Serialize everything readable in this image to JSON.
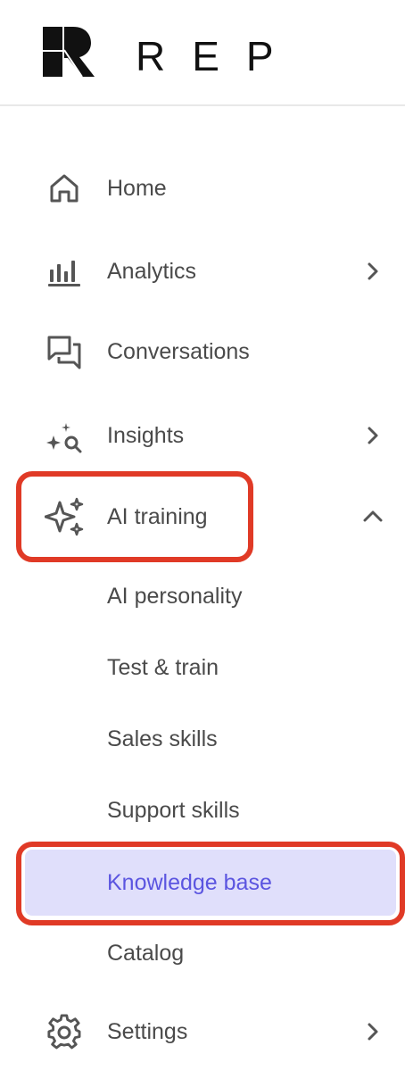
{
  "brand": {
    "wordmark": "REP"
  },
  "nav": {
    "home": {
      "label": "Home",
      "icon": "home-icon"
    },
    "analytics": {
      "label": "Analytics",
      "icon": "bar-chart-icon"
    },
    "conversations": {
      "label": "Conversations",
      "icon": "chat-bubbles-icon"
    },
    "insights": {
      "label": "Insights",
      "icon": "sparkle-search-icon"
    },
    "ai_training": {
      "label": "AI training",
      "icon": "sparkles-icon",
      "expanded": true,
      "children": [
        {
          "label": "AI personality"
        },
        {
          "label": "Test & train"
        },
        {
          "label": "Sales skills"
        },
        {
          "label": "Support skills"
        },
        {
          "label": "Knowledge base",
          "active": true
        },
        {
          "label": "Catalog"
        }
      ]
    },
    "settings": {
      "label": "Settings",
      "icon": "gear-icon"
    }
  },
  "colors": {
    "active_bg": "#e0dffb",
    "active_text": "#5b55e0",
    "highlight": "#e03a26",
    "icon": "#555555"
  }
}
